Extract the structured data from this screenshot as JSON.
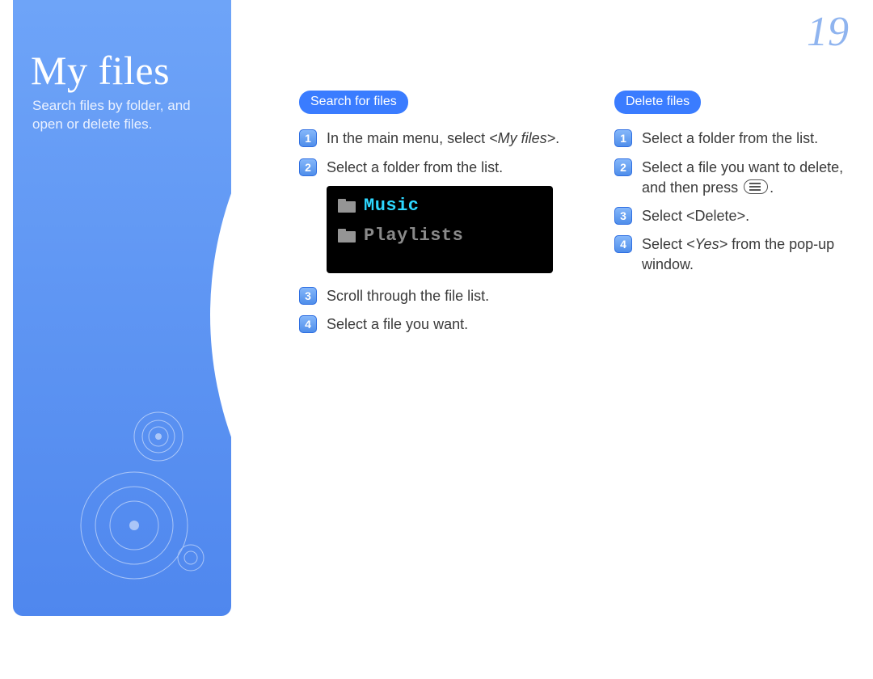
{
  "page_number": "19",
  "sidebar": {
    "title": "My files",
    "subtitle": "Search files by folder, and open or delete files."
  },
  "columns": {
    "search": {
      "heading": "Search for files",
      "steps": [
        "In the main menu, select <My files>.",
        "Select a folder from the list.",
        "Scroll through the file list.",
        "Select a file you want."
      ],
      "step1_pre": "In the main menu, select ",
      "step1_em": "<My files>",
      "step1_post": "."
    },
    "delete": {
      "heading": "Delete files",
      "steps": [
        "Select a folder from the list.",
        "Select a file you want to delete, and then press ",
        "Select <Delete>.",
        "Select <Yes> from the pop-up window."
      ],
      "step2_post": ".",
      "step4_pre": "Select ",
      "step4_em": "<Yes>",
      "step4_post": " from the pop-up window."
    }
  },
  "device": {
    "items": [
      "Music",
      "Playlists"
    ]
  }
}
